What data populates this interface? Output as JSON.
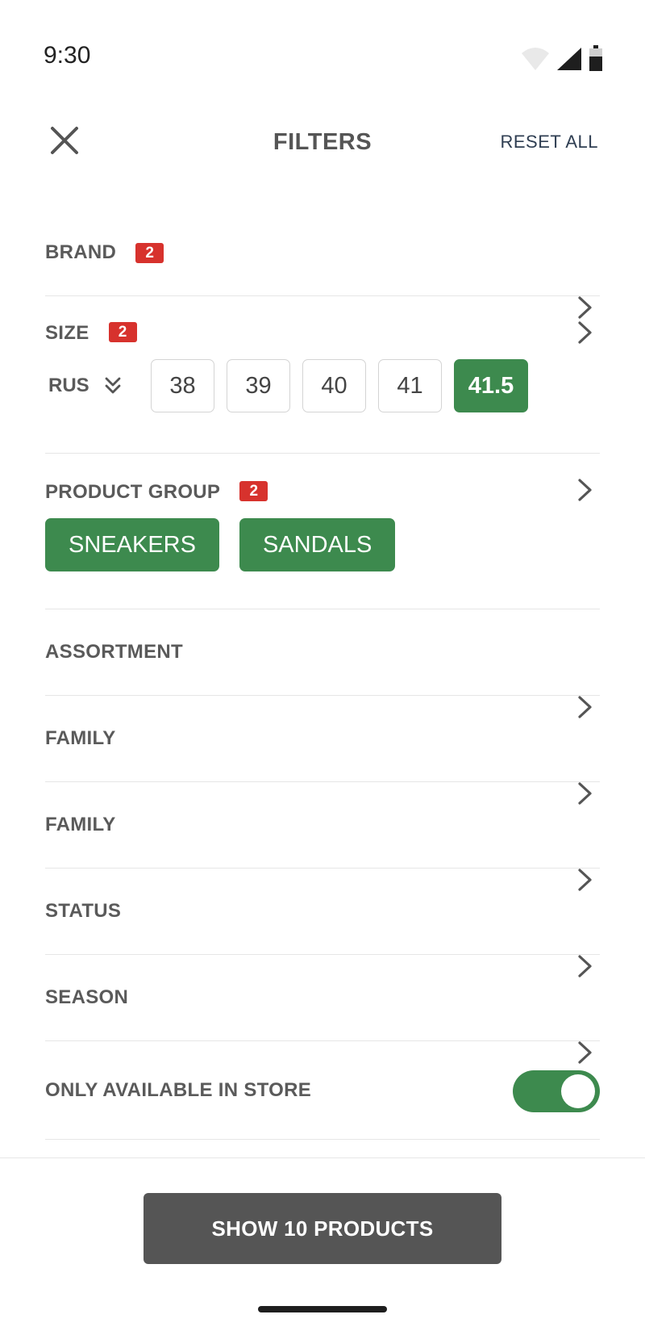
{
  "status_bar": {
    "time": "9:30",
    "icons": [
      "wifi-icon",
      "cell-signal-icon",
      "battery-icon"
    ]
  },
  "header": {
    "title": "FILTERS",
    "reset_label": "RESET ALL",
    "close_icon": "close-icon"
  },
  "filters": {
    "brand": {
      "label": "BRAND",
      "badge": "2"
    },
    "size": {
      "label": "SIZE",
      "badge": "2",
      "unit": "RUS",
      "options": [
        "38",
        "39",
        "40",
        "41",
        "41.5"
      ],
      "selected": "41.5"
    },
    "product_group": {
      "label": "PRODUCT GROUP",
      "badge": "2",
      "chips": [
        "SNEAKERS",
        "SANDALS"
      ]
    },
    "assortment": {
      "label": "ASSORTMENT"
    },
    "family_1": {
      "label": "FAMILY"
    },
    "family_2": {
      "label": "FAMILY"
    },
    "status": {
      "label": "STATUS"
    },
    "season": {
      "label": "SEASON"
    },
    "only_available": {
      "label": "ONLY AVAILABLE IN STORE",
      "enabled": true
    }
  },
  "footer": {
    "cta_label": "SHOW 10 PRODUCTS"
  },
  "colors": {
    "accent_green": "#3d8a4e",
    "badge_red": "#d7322d",
    "cta_gray": "#555555",
    "reset_blue": "#2f3e52"
  }
}
